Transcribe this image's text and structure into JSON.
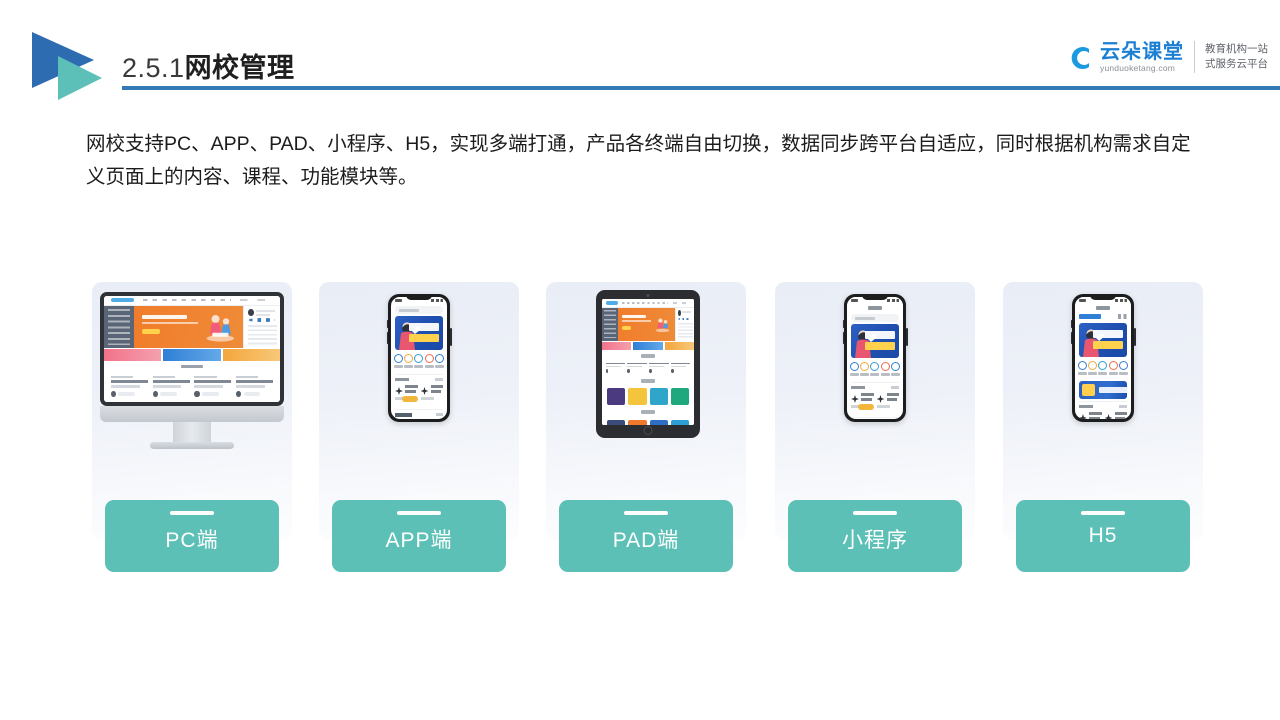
{
  "header": {
    "section_number": "2.5.1",
    "section_title": "网校管理",
    "rule_color": "#3479b5",
    "logo_colors": {
      "primary": "#2d6cb0",
      "secondary": "#5cc0b8"
    }
  },
  "brand": {
    "name_cn": "云朵课堂",
    "name_en": "yunduoketang.com",
    "tagline_line1": "教育机构一站",
    "tagline_line2": "式服务云平台",
    "color": "#1b7fd4"
  },
  "body": {
    "paragraph": "网校支持PC、APP、PAD、小程序、H5，实现多端打通，产品各终端自由切换，数据同步跨平台自适应，同时根据机构需求自定义页面上的内容、课程、功能模块等。"
  },
  "platform_cards": [
    {
      "id": "pc",
      "label": "PC端",
      "device": "desktop-monitor"
    },
    {
      "id": "app",
      "label": "APP端",
      "device": "smartphone"
    },
    {
      "id": "pad",
      "label": "PAD端",
      "device": "tablet"
    },
    {
      "id": "mini",
      "label": "小程序",
      "device": "smartphone"
    },
    {
      "id": "h5",
      "label": "H5",
      "device": "smartphone"
    }
  ],
  "theme": {
    "pill_color": "#5cc0b7",
    "pill_text_color": "#ffffff",
    "card_background": "#eef1f8",
    "page_background": "#ffffff"
  }
}
